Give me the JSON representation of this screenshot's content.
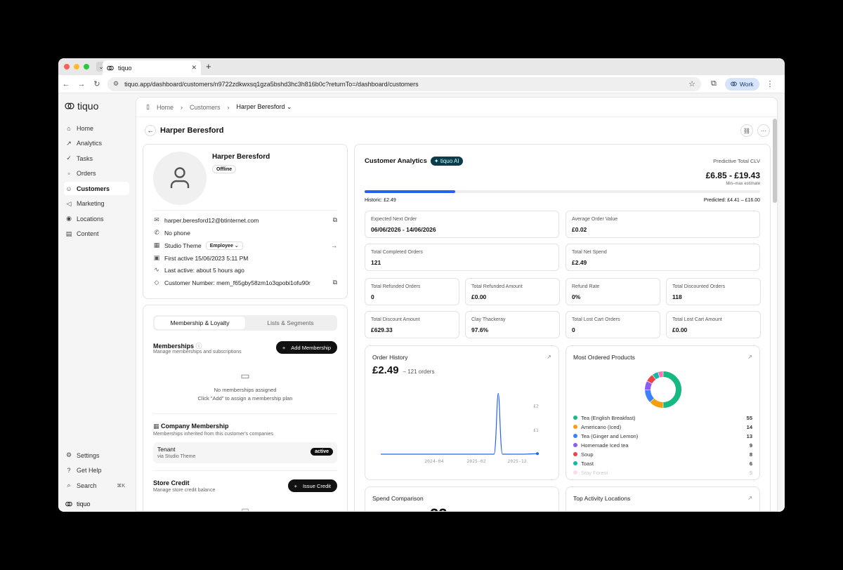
{
  "browser": {
    "tab_title": "tiquo",
    "url": "tiquo.app/dashboard/customers/n9722zdkwxsq1gza5bshd3hc3h816b0c?returnTo=/dashboard/customers",
    "profile": "Work",
    "traffic_colors": [
      "#ff5f57",
      "#febc2e",
      "#28c840"
    ]
  },
  "sidebar": {
    "brand": "tiquo",
    "items": [
      {
        "label": "Home",
        "icon": "home-icon",
        "glyph": "⌂"
      },
      {
        "label": "Analytics",
        "icon": "analytics-icon",
        "glyph": "↗"
      },
      {
        "label": "Tasks",
        "icon": "tasks-icon",
        "glyph": "✓"
      },
      {
        "label": "Orders",
        "icon": "cart-icon",
        "glyph": "▫"
      },
      {
        "label": "Customers",
        "icon": "users-icon",
        "glyph": "☺"
      },
      {
        "label": "Marketing",
        "icon": "megaphone-icon",
        "glyph": "◁"
      },
      {
        "label": "Locations",
        "icon": "pin-icon",
        "glyph": "◉"
      },
      {
        "label": "Content",
        "icon": "document-icon",
        "glyph": "▤"
      }
    ],
    "bottom": {
      "settings": "Settings",
      "help": "Get Help",
      "search": "Search",
      "search_kbd": "⌘K",
      "brand": "tiquo"
    }
  },
  "breadcrumb": {
    "home": "Home",
    "customers": "Customers",
    "current": "Harper Beresford"
  },
  "page_title": "Harper Beresford",
  "profile": {
    "name": "Harper Beresford",
    "status": "Offline",
    "email": "harper.beresford12@btinternet.com",
    "phone": "No phone",
    "company": "Studio Theme",
    "role": "Employee",
    "first_active": "First active 15/06/2023 5:11 PM",
    "last_active": "Last active: about 5 hours ago",
    "customer_number": "Customer Number: mem_f65gby58zm1o3qpobi1ofu90r"
  },
  "membership": {
    "tabs": [
      "Membership & Loyalty",
      "Lists & Segments"
    ],
    "memberships_title": "Memberships",
    "memberships_sub": "Manage memberships and subscriptions",
    "add_membership": "Add Membership",
    "empty_1": "No memberships assigned",
    "empty_2": "Click \"Add\" to assign a membership plan",
    "company_title": "Company Membership",
    "company_sub": "Memberships inherited from this customer's companies",
    "tenant_name": "Tenant",
    "tenant_via": "via Studio Theme",
    "tenant_status": "active",
    "store_title": "Store Credit",
    "store_sub": "Manage store credit balance",
    "issue_credit": "Issue Credit"
  },
  "analytics": {
    "title": "Customer Analytics",
    "ai_badge": "tiquo AI",
    "clv_label": "Predictive Total CLV",
    "clv_value": "£6.85 - £19.43",
    "clv_sub": "Min–max estimate",
    "historic": "Historic: £2.49",
    "predicted": "Predicted: £4.41 – £16.00",
    "historic_fraction": 0.23,
    "accent": "#2563eb",
    "stats_wide": [
      {
        "label": "Expected Next Order",
        "value": "06/06/2026 - 14/06/2026"
      },
      {
        "label": "Average Order Value",
        "value": "£0.02"
      },
      {
        "label": "Total Completed Orders",
        "value": "121"
      },
      {
        "label": "Total Net Spend",
        "value": "£2.49"
      }
    ],
    "stats_small": [
      {
        "label": "Total Refunded Orders",
        "value": "0"
      },
      {
        "label": "Total Refunded Amount",
        "value": "£0.00"
      },
      {
        "label": "Refund Rate",
        "value": "0%"
      },
      {
        "label": "Total Discounted Orders",
        "value": "118"
      },
      {
        "label": "Total Discount Amount",
        "value": "£629.33"
      },
      {
        "label": "Clay Thackeray",
        "value": "97.6%"
      },
      {
        "label": "Total Lost Cart Orders",
        "value": "0"
      },
      {
        "label": "Total Lost Cart Amount",
        "value": "£0.00"
      }
    ],
    "order_history_title": "Order History",
    "order_history_total": "£2.49",
    "order_history_count": "– 121 orders",
    "spend_comparison_title": "Spend Comparison",
    "spend_comparison_value": "22",
    "most_ordered_title": "Most Ordered Products",
    "top_locations_title": "Top Activity Locations"
  },
  "chart_data": [
    {
      "type": "line",
      "title": "Order History",
      "x_ticks": [
        "2024-04",
        "2025-02",
        "2025-12"
      ],
      "y_ticks": [
        "£2",
        "£1"
      ],
      "ylim": [
        0,
        2.7
      ],
      "x": [
        "2023-06",
        "2023-10",
        "2024-02",
        "2024-06",
        "2024-10",
        "2025-02",
        "2025-06",
        "2025-10",
        "2026-01",
        "2026-02",
        "2026-03",
        "2026-04",
        "2026-05"
      ],
      "values": [
        0,
        0,
        0,
        0,
        0,
        0,
        0,
        0,
        0,
        2.49,
        0,
        0,
        0.02
      ],
      "color": "#2563eb",
      "grid": false
    },
    {
      "type": "pie",
      "title": "Most Ordered Products",
      "donut": true,
      "categories": [
        "Tea (English Breakfast)",
        "Americano (Iced)",
        "Tea (Ginger and Lemon)",
        "Homemade Iced tea",
        "Soup",
        "Toast",
        "Stay Forest"
      ],
      "values": [
        55,
        14,
        13,
        9,
        8,
        6,
        5
      ],
      "colors": [
        "#16b981",
        "#f59e0b",
        "#3b82f6",
        "#8b5cf6",
        "#ef4444",
        "#14b8a6",
        "#f472b6"
      ]
    }
  ]
}
